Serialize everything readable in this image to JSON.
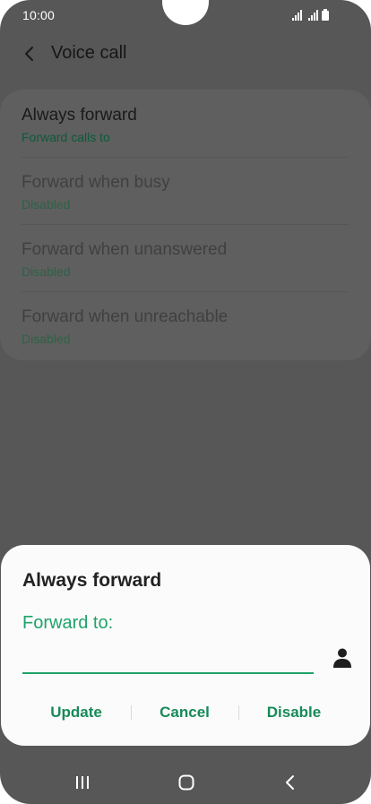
{
  "status_bar": {
    "time": "10:00",
    "icons": [
      "signal-sim1-icon",
      "signal-sim2-icon",
      "battery-icon"
    ]
  },
  "app_bar": {
    "title": "Voice call",
    "back_icon": "chevron-left-icon"
  },
  "settings": {
    "items": [
      {
        "title": "Always forward",
        "subtitle": "Forward calls to"
      },
      {
        "title": "Forward when busy",
        "subtitle": "Disabled"
      },
      {
        "title": "Forward when unanswered",
        "subtitle": "Disabled"
      },
      {
        "title": "Forward when unreachable",
        "subtitle": "Disabled"
      }
    ]
  },
  "dialog": {
    "title": "Always forward",
    "field_label": "Forward to:",
    "field_value": "",
    "contact_icon": "person-icon",
    "buttons": {
      "update": "Update",
      "cancel": "Cancel",
      "disable": "Disable"
    }
  },
  "nav_bar": {
    "icons": [
      "recent-apps-icon",
      "home-icon",
      "back-icon"
    ]
  },
  "colors": {
    "accent_green": "#1fa36a",
    "button_green": "#178a59",
    "scrim": "#575757",
    "dialog_background": "#fbfbfb"
  }
}
